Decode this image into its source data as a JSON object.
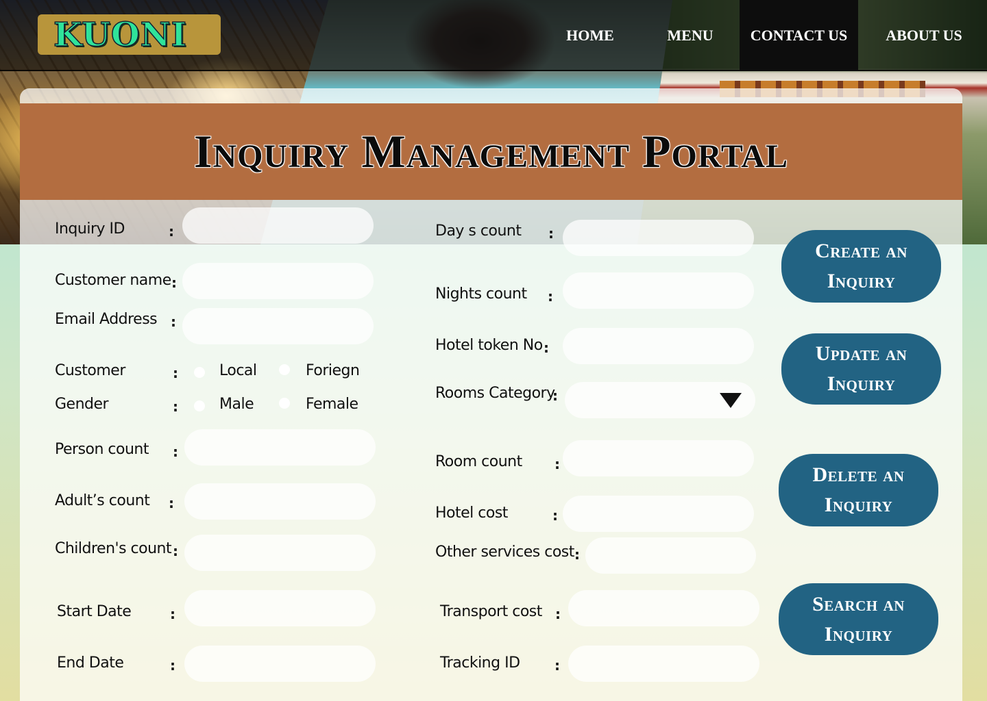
{
  "header": {
    "logo": "KUONI",
    "nav": [
      "HOME",
      "MENU",
      "CONTACT US",
      "ABOUT US"
    ],
    "active_nav": "CONTACT US"
  },
  "page_title": "Inquiry Management Portal",
  "form": {
    "left": {
      "inquiry_id": "Inquiry ID",
      "customer_name": "Customer name",
      "email": "Email Address",
      "customer": "Customer",
      "customer_options": [
        "Local",
        "Foriegn"
      ],
      "gender": "Gender",
      "gender_options": [
        "Male",
        "Female"
      ],
      "person_count": "Person count",
      "adults_count": "Adult’s count",
      "children_count": "Children's count",
      "start_date": "Start Date",
      "end_date": "End Date"
    },
    "right": {
      "days_count": "Day s count",
      "nights_count": "Nights count",
      "hotel_token": "Hotel token No",
      "rooms_category": "Rooms Category",
      "room_count": "Room count",
      "hotel_cost": "Hotel cost",
      "other_services_cost": "Other services  cost",
      "transport_cost": "Transport cost",
      "tracking_id": "Tracking ID"
    },
    "colon": ":"
  },
  "actions": {
    "create": "Create an Inquiry",
    "update": "Update an Inquiry",
    "delete": "Delete  an Inquiry",
    "search": "Search an Inquiry"
  },
  "colors": {
    "banner": "#b36d40",
    "button": "#226383",
    "logo_bg": "#b8953b",
    "logo_text": "#2fe39a"
  },
  "icons": {
    "rooms_dropdown": "caret-down-icon"
  }
}
